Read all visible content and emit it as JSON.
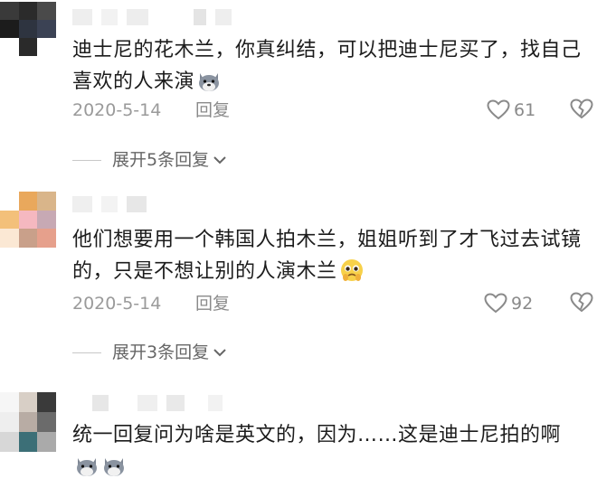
{
  "comments": [
    {
      "text": "迪士尼的花木兰，你真纠结，可以把迪士尼买了，找自己喜欢的人来演",
      "emoji": "dog-face-emoji",
      "date": "2020-5-14",
      "reply_label": "回复",
      "likes": "61"
    },
    {
      "text": "他们想要用一个韩国人拍木兰，姐姐听到了才飞过去试镜的，只是不想让别的人演木兰",
      "emoji": "pleading-face-emoji",
      "date": "2020-5-14",
      "reply_label": "回复",
      "likes": "92"
    },
    {
      "text": "统一回复问为啥是英文的，因为……这是迪士尼拍的啊",
      "emoji": "dog-face-emoji"
    }
  ],
  "expand_replies": [
    {
      "label": "展开5条回复"
    },
    {
      "label": "展开3条回复"
    }
  ],
  "colors": {
    "text": "#1c1c1c",
    "meta": "#9a9a9a",
    "icon_stroke": "#8a8a8a"
  }
}
